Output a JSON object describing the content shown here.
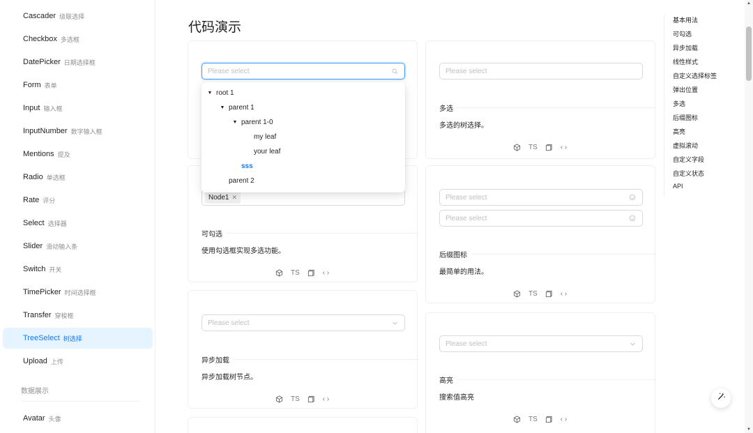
{
  "sidebar": {
    "items": [
      {
        "label": "Cascader",
        "sub": "级联选择"
      },
      {
        "label": "Checkbox",
        "sub": "多选框"
      },
      {
        "label": "DatePicker",
        "sub": "日期选择框"
      },
      {
        "label": "Form",
        "sub": "表单"
      },
      {
        "label": "Input",
        "sub": "输入框"
      },
      {
        "label": "InputNumber",
        "sub": "数字输入框"
      },
      {
        "label": "Mentions",
        "sub": "提及"
      },
      {
        "label": "Radio",
        "sub": "单选框"
      },
      {
        "label": "Rate",
        "sub": "评分"
      },
      {
        "label": "Select",
        "sub": "选择器"
      },
      {
        "label": "Slider",
        "sub": "滑动输入条"
      },
      {
        "label": "Switch",
        "sub": "开关"
      },
      {
        "label": "TimePicker",
        "sub": "时间选择框"
      },
      {
        "label": "Transfer",
        "sub": "穿梭框"
      },
      {
        "label": "TreeSelect",
        "sub": "树选择"
      },
      {
        "label": "Upload",
        "sub": "上传"
      }
    ],
    "group_label": "数据展示",
    "last_item": {
      "label": "Avatar",
      "sub": "头像"
    },
    "active_index": 14
  },
  "main": {
    "title": "代码演示",
    "placeholder": "Please select",
    "dropdown": {
      "nodes": [
        "root 1",
        "parent 1",
        "parent 1-0",
        "my leaf",
        "your leaf",
        "sss",
        "parent 2"
      ]
    },
    "cards": {
      "checkable": {
        "tag": "Node1",
        "title": "可勾选",
        "desc": "使用勾选框实现多选功能。"
      },
      "async": {
        "title": "异步加载",
        "desc": "异步加载树节点。"
      },
      "multiple": {
        "title": "多选",
        "desc": "多选的树选择。"
      },
      "suffix": {
        "title": "后缀图标",
        "desc": "最简单的用法。"
      },
      "highlight": {
        "title": "高亮",
        "desc": "搜索值高亮"
      }
    },
    "actions": {
      "ts": "TS",
      "code": "‹ ›"
    }
  },
  "anchor": {
    "items": [
      "基本用法",
      "可勾选",
      "异步加载",
      "线性样式",
      "自定义选择标签",
      "弹出位置",
      "多选",
      "后缀图标",
      "高亮",
      "虚拟滚动",
      "自定义字段",
      "自定义状态",
      "API"
    ]
  },
  "colors": {
    "primary": "#1677ff",
    "active_bg": "#e6f4ff",
    "border": "#d9d9d9"
  }
}
